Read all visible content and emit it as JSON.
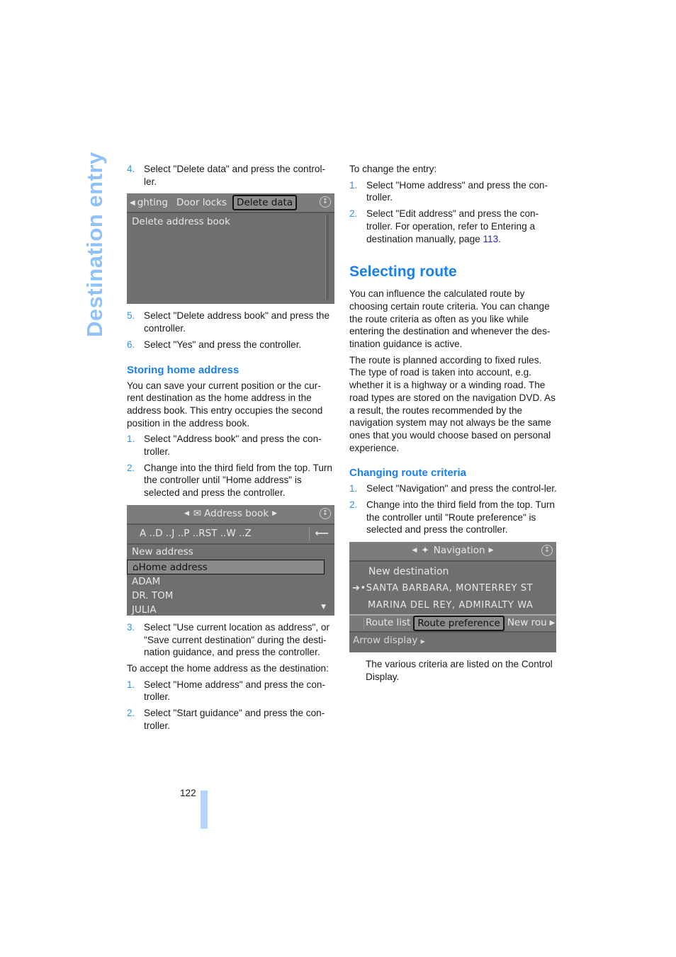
{
  "side_title": "Destination entry",
  "page_number": "122",
  "colors": {
    "accent": "#1a7ff0",
    "side_title": "#8ec2f8",
    "step_number": "#3b8fe0",
    "link": "#2525d6",
    "screen_bg": "#6f6f6f"
  },
  "left": {
    "step4": {
      "num": "4.",
      "text": "Select \"Delete data\" and press the control-ler."
    },
    "screen1": {
      "tabs": [
        "ghting",
        "Door locks",
        "Delete data"
      ],
      "selected_tab": "Delete data",
      "items": [
        "Delete address book"
      ],
      "icons": [
        "arrow-left-icon",
        "controller-icon"
      ]
    },
    "step5": {
      "num": "5.",
      "text": "Select \"Delete address book\" and press the controller."
    },
    "step6": {
      "num": "6.",
      "text": "Select \"Yes\" and press the controller."
    },
    "storing_heading": "Storing home address",
    "storing_para": "You can save your current position or the cur-rent destination as the home address in the address book. This entry occupies the second position in the address book.",
    "storing_steps": [
      {
        "num": "1.",
        "text": "Select \"Address book\" and press the con-troller."
      },
      {
        "num": "2.",
        "text": "Change into the third field from the top. Turn the controller until \"Home address\" is selected and press the controller."
      }
    ],
    "screen2": {
      "title": "Address book",
      "alphabet": "A ..D ..J ..P ..RST ..W ..Z",
      "back_icon": "⟵",
      "items": [
        "New address",
        "Home address",
        "ADAM",
        "DR. TOM",
        "JULIA"
      ],
      "selected_item": "Home address"
    },
    "step3": {
      "num": "3.",
      "text": "Select \"Use current location as address\", or \"Save current destination\" during the desti-nation guidance, and press the controller."
    },
    "accept_para": "To accept the home address as the destination:",
    "accept_steps": [
      {
        "num": "1.",
        "text": "Select \"Home address\" and press the con-troller."
      },
      {
        "num": "2.",
        "text": "Select \"Start guidance\" and press the con-troller."
      }
    ]
  },
  "right": {
    "change_intro": "To change the entry:",
    "change_steps": [
      {
        "num": "1.",
        "text": "Select \"Home address\" and press the con-troller."
      },
      {
        "num": "2.",
        "text_before": "Select \"Edit address\" and press the con-troller. For operation, refer to Entering a destination manually, page ",
        "link": "113",
        "text_after": "."
      }
    ],
    "selecting_heading": "Selecting route",
    "selecting_para1": "You can influence the calculated route by choosing certain route criteria. You can change the route criteria as often as you like while entering the destination and whenever the des-tination guidance is active.",
    "selecting_para2": "The route is planned according to fixed rules. The type of road is taken into account, e.g. whether it is a highway or a winding road. The road types are stored on the navigation DVD. As a result, the routes recommended by the navigation system may not always be the same ones that you would choose based on personal experience.",
    "criteria_heading": "Changing route criteria",
    "criteria_steps": [
      {
        "num": "1.",
        "text": "Select \"Navigation\" and press the control-ler."
      },
      {
        "num": "2.",
        "text": "Change into the third field from the top. Turn the controller until \"Route preference\" is selected and press the controller."
      }
    ],
    "screen3": {
      "title": "Navigation",
      "items": [
        "New destination",
        "SANTA BARBARA, MONTERREY ST",
        "MARINA DEL REY, ADMIRALTY WA"
      ],
      "tabs": [
        "Route list",
        "Route preference",
        "New rou"
      ],
      "selected_tab": "Route preference",
      "bottom_item": "Arrow display"
    },
    "closing_para": "The various criteria are listed on the Control Display."
  }
}
